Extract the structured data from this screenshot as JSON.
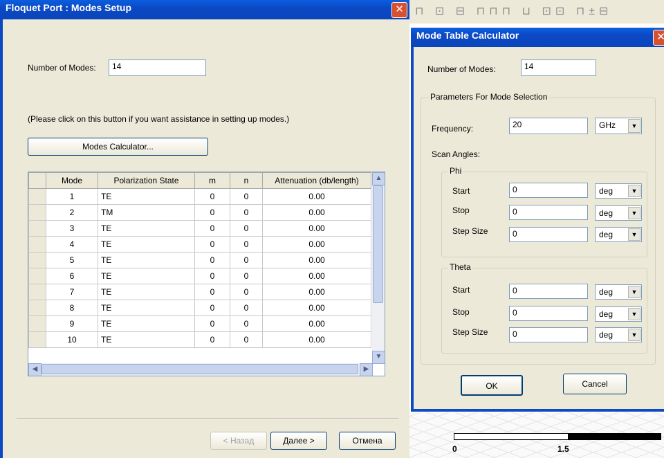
{
  "floquet": {
    "title": "Floquet Port : Modes Setup",
    "close": "✕",
    "num_modes_label": "Number of Modes:",
    "num_modes_value": "14",
    "hint": "(Please click on this button if you want assistance in setting up modes.)",
    "calc_button": "Modes Calculator...",
    "columns": [
      "Mode",
      "Polarization State",
      "m",
      "n",
      "Attenuation (db/length)"
    ],
    "rows": [
      {
        "mode": "1",
        "pol": "TE",
        "m": "0",
        "n": "0",
        "att": "0.00"
      },
      {
        "mode": "2",
        "pol": "TM",
        "m": "0",
        "n": "0",
        "att": "0.00"
      },
      {
        "mode": "3",
        "pol": "TE",
        "m": "0",
        "n": "0",
        "att": "0.00"
      },
      {
        "mode": "4",
        "pol": "TE",
        "m": "0",
        "n": "0",
        "att": "0.00"
      },
      {
        "mode": "5",
        "pol": "TE",
        "m": "0",
        "n": "0",
        "att": "0.00"
      },
      {
        "mode": "6",
        "pol": "TE",
        "m": "0",
        "n": "0",
        "att": "0.00"
      },
      {
        "mode": "7",
        "pol": "TE",
        "m": "0",
        "n": "0",
        "att": "0.00"
      },
      {
        "mode": "8",
        "pol": "TE",
        "m": "0",
        "n": "0",
        "att": "0.00"
      },
      {
        "mode": "9",
        "pol": "TE",
        "m": "0",
        "n": "0",
        "att": "0.00"
      },
      {
        "mode": "10",
        "pol": "TE",
        "m": "0",
        "n": "0",
        "att": "0.00"
      }
    ],
    "back": "< Назад",
    "next": "Далее >",
    "cancel": "Отмена"
  },
  "calculator": {
    "title": "Mode Table Calculator",
    "close": "✕",
    "num_modes_label": "Number of Modes:",
    "num_modes_value": "14",
    "params_group": "Parameters For Mode Selection",
    "freq_label": "Frequency:",
    "freq_value": "20",
    "freq_unit": "GHz",
    "scan_label": "Scan Angles:",
    "phi_group": "Phi",
    "theta_group": "Theta",
    "start_label": "Start",
    "stop_label": "Stop",
    "step_label": "Step Size",
    "angle_value": "0",
    "angle_unit": "deg",
    "ok": "OK",
    "cancel": "Cancel"
  },
  "background": {
    "scale_0": "0",
    "scale_1": "1.5"
  }
}
